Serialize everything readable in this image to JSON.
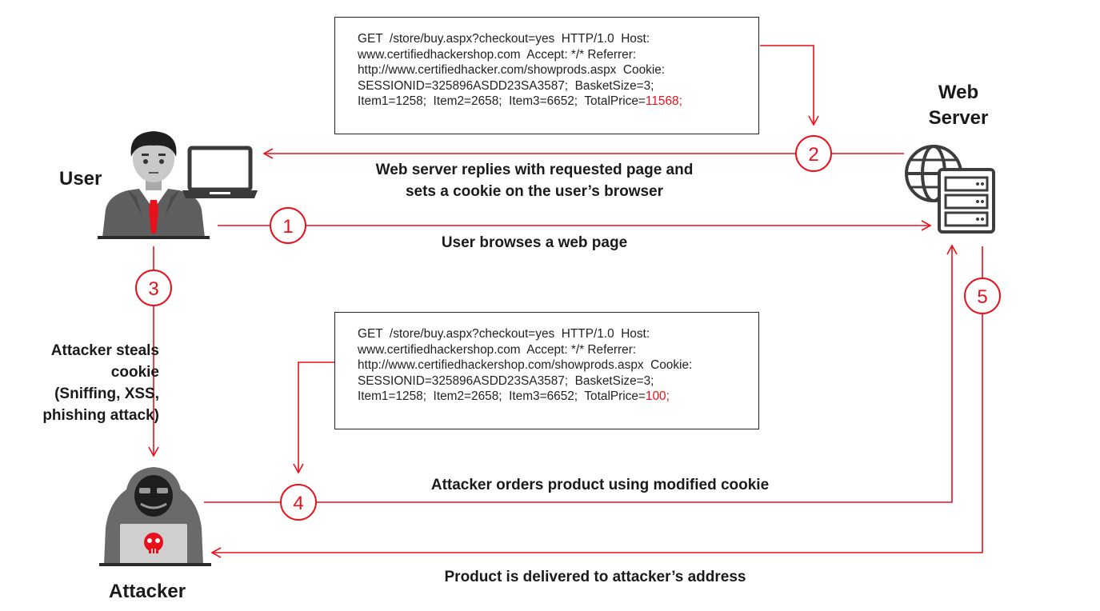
{
  "actors": {
    "user": "User",
    "server_line1": "Web",
    "server_line2": "Server",
    "attacker": "Attacker"
  },
  "steps": {
    "s1": {
      "number": "1",
      "text": "User browses a web page"
    },
    "s2": {
      "number": "2",
      "line1": "Web server replies with requested page and",
      "line2": "sets a cookie on the user’s browser"
    },
    "s3": {
      "number": "3",
      "line1": "Attacker steals",
      "line2": "cookie",
      "line3": "(Sniffing, XSS,",
      "line4": "phishing attack)"
    },
    "s4": {
      "number": "4",
      "text": "Attacker orders product using modified cookie"
    },
    "s5": {
      "number": "5",
      "text": "Product is delivered to attacker’s address"
    }
  },
  "request_original": {
    "line1": "GET  /store/buy.aspx?checkout=yes  HTTP/1.0  Host:",
    "line2": "www.certifiedhackershop.com  Accept: */* Referrer:",
    "line3": "http://www.certifiedhacker.com/showprods.aspx  Cookie:",
    "line4": "SESSIONID=325896ASDD23SA3587;  BasketSize=3;",
    "line5_prefix": "Item1=1258;  Item2=2658;  Item3=6652;  TotalPrice=",
    "line5_value": "11568;"
  },
  "request_modified": {
    "line1": "GET  /store/buy.aspx?checkout=yes  HTTP/1.0  Host:",
    "line2": "www.certifiedhackershop.com  Accept: */* Referrer:",
    "line3": "http://www.certifiedhackershop.com/showprods.aspx  Cookie:",
    "line4": "SESSIONID=325896ASDD23SA3587;  BasketSize=3;",
    "line5_prefix": "Item1=1258;  Item2=2658;  Item3=6652;  TotalPrice=",
    "line5_value": "100;"
  },
  "colors": {
    "arrow": "#e8101a",
    "text": "#1a1a1a",
    "icon_dark": "#3a3a3a",
    "icon_mid": "#6b6b6b",
    "tie": "#e8101a"
  }
}
